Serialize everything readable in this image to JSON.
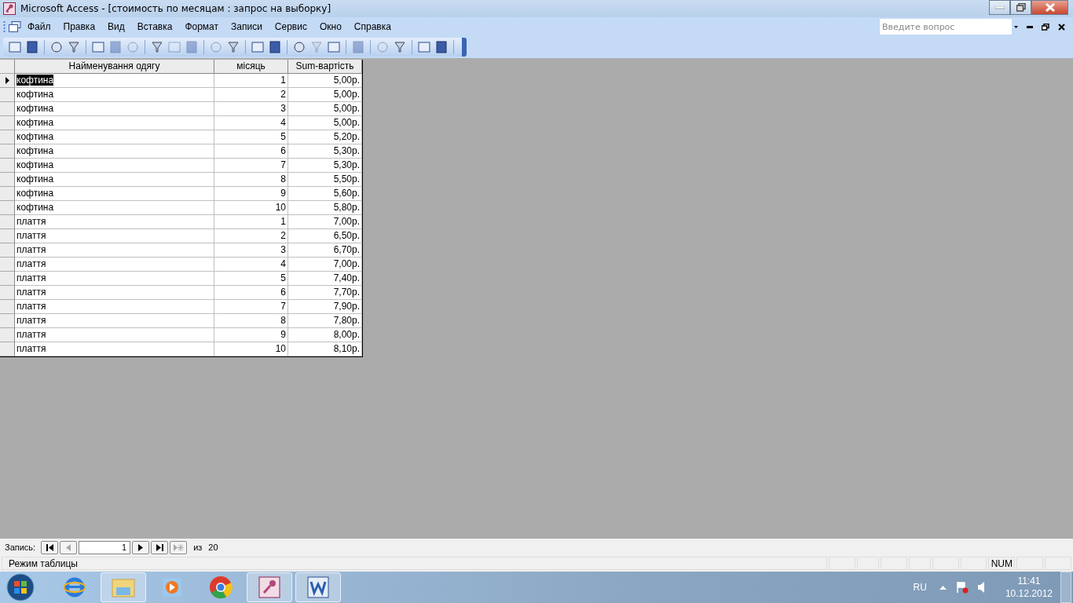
{
  "window": {
    "title": "Microsoft Access - [стоимость по месяцам : запрос на выборку]"
  },
  "menu": [
    "Файл",
    "Правка",
    "Вид",
    "Вставка",
    "Формат",
    "Записи",
    "Сервис",
    "Окно",
    "Справка"
  ],
  "help_search": {
    "placeholder": "Введите вопрос"
  },
  "table": {
    "columns": [
      "Найменування одягу",
      "місяць",
      "Sum-вартість"
    ],
    "rows": [
      {
        "cells": [
          "кофтина",
          "1",
          "5,00р."
        ],
        "selected": true
      },
      {
        "cells": [
          "кофтина",
          "2",
          "5,00р."
        ],
        "selected": false
      },
      {
        "cells": [
          "кофтина",
          "3",
          "5,00р."
        ],
        "selected": false
      },
      {
        "cells": [
          "кофтина",
          "4",
          "5,00р."
        ],
        "selected": false
      },
      {
        "cells": [
          "кофтина",
          "5",
          "5,20р."
        ],
        "selected": false
      },
      {
        "cells": [
          "кофтина",
          "6",
          "5,30р."
        ],
        "selected": false
      },
      {
        "cells": [
          "кофтина",
          "7",
          "5,30р."
        ],
        "selected": false
      },
      {
        "cells": [
          "кофтина",
          "8",
          "5,50р."
        ],
        "selected": false
      },
      {
        "cells": [
          "кофтина",
          "9",
          "5,60р."
        ],
        "selected": false
      },
      {
        "cells": [
          "кофтина",
          "10",
          "5,80р."
        ],
        "selected": false
      },
      {
        "cells": [
          "плаття",
          "1",
          "7,00р."
        ],
        "selected": false
      },
      {
        "cells": [
          "плаття",
          "2",
          "6,50р."
        ],
        "selected": false
      },
      {
        "cells": [
          "плаття",
          "3",
          "6,70р."
        ],
        "selected": false
      },
      {
        "cells": [
          "плаття",
          "4",
          "7,00р."
        ],
        "selected": false
      },
      {
        "cells": [
          "плаття",
          "5",
          "7,40р."
        ],
        "selected": false
      },
      {
        "cells": [
          "плаття",
          "6",
          "7,70р."
        ],
        "selected": false
      },
      {
        "cells": [
          "плаття",
          "7",
          "7,90р."
        ],
        "selected": false
      },
      {
        "cells": [
          "плаття",
          "8",
          "7,80р."
        ],
        "selected": false
      },
      {
        "cells": [
          "плаття",
          "9",
          "8,00р."
        ],
        "selected": false
      },
      {
        "cells": [
          "плаття",
          "10",
          "8,10р."
        ],
        "selected": false
      }
    ]
  },
  "record_navigator": {
    "label": "Запись:",
    "current": "1",
    "of_label": "из",
    "total": "20"
  },
  "status_bar": {
    "text": "Режим таблицы",
    "indicator": "NUM"
  },
  "taskbar": {
    "language": "RU",
    "time": "11:41",
    "date": "10.12.2012"
  }
}
